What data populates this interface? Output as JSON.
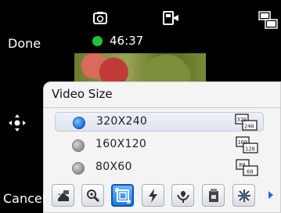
{
  "status_bar": {
    "icons": [
      "camera-mode-icon",
      "video-record-icon",
      "resolution-320x240-icon"
    ]
  },
  "left_softkeys": {
    "done": "Done",
    "cancel": "Cancel"
  },
  "recording": {
    "timer": "46:37",
    "indicator_color": "#22c13a"
  },
  "panel": {
    "title": "Video Size",
    "options": [
      {
        "label": "320X240",
        "selected": true,
        "icon": "res-320x240-icon",
        "icon_top": "320",
        "icon_bottom": "240"
      },
      {
        "label": "160X120",
        "selected": false,
        "icon": "res-160x120-icon",
        "icon_top": "160",
        "icon_bottom": "120"
      },
      {
        "label": "80X60",
        "selected": false,
        "icon": "res-80x60-icon",
        "icon_top": "80",
        "icon_bottom": "60"
      }
    ]
  },
  "toolbar": {
    "buttons": [
      {
        "name": "capture-mode-icon",
        "active": false
      },
      {
        "name": "zoom-icon",
        "active": false
      },
      {
        "name": "video-size-icon",
        "active": true
      },
      {
        "name": "flash-icon",
        "active": false
      },
      {
        "name": "macro-icon",
        "active": false
      },
      {
        "name": "storage-icon",
        "active": false
      },
      {
        "name": "effects-icon",
        "active": false
      }
    ],
    "accent_color": "#1e7ae0"
  }
}
